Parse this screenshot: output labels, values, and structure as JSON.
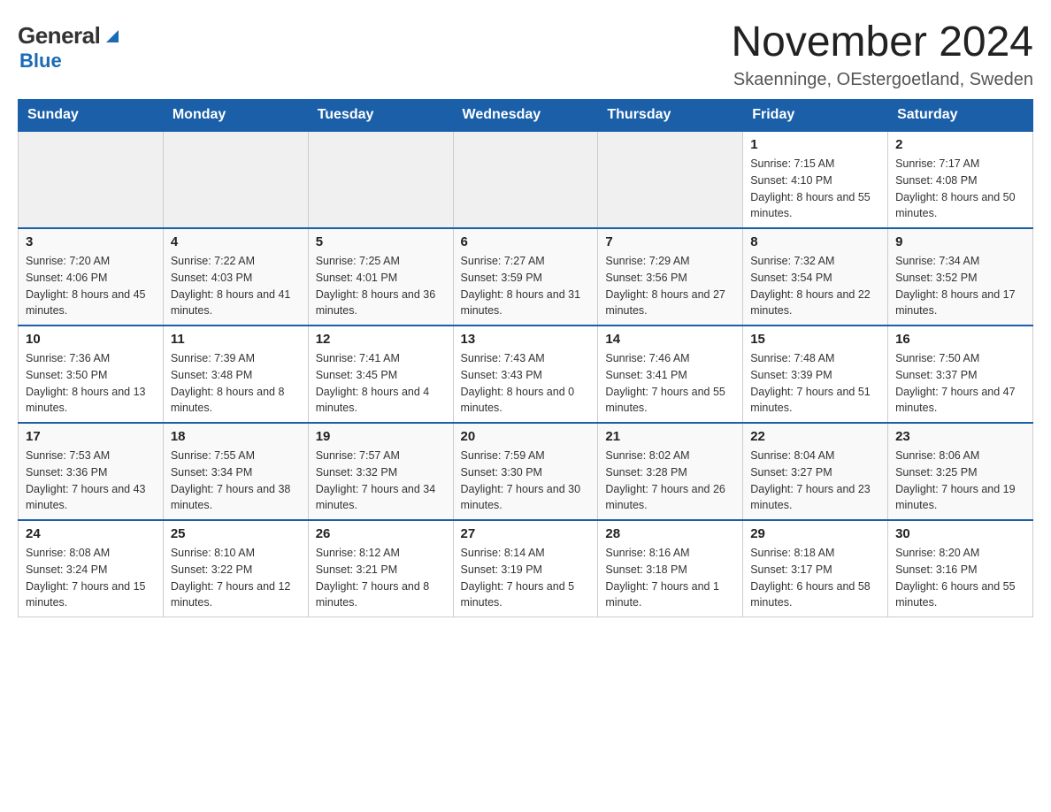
{
  "header": {
    "logo_general": "General",
    "logo_blue": "Blue",
    "main_title": "November 2024",
    "subtitle": "Skaenninge, OEstergoetland, Sweden"
  },
  "calendar": {
    "days_of_week": [
      "Sunday",
      "Monday",
      "Tuesday",
      "Wednesday",
      "Thursday",
      "Friday",
      "Saturday"
    ],
    "weeks": [
      [
        {
          "day": "",
          "info": ""
        },
        {
          "day": "",
          "info": ""
        },
        {
          "day": "",
          "info": ""
        },
        {
          "day": "",
          "info": ""
        },
        {
          "day": "",
          "info": ""
        },
        {
          "day": "1",
          "info": "Sunrise: 7:15 AM\nSunset: 4:10 PM\nDaylight: 8 hours and 55 minutes."
        },
        {
          "day": "2",
          "info": "Sunrise: 7:17 AM\nSunset: 4:08 PM\nDaylight: 8 hours and 50 minutes."
        }
      ],
      [
        {
          "day": "3",
          "info": "Sunrise: 7:20 AM\nSunset: 4:06 PM\nDaylight: 8 hours and 45 minutes."
        },
        {
          "day": "4",
          "info": "Sunrise: 7:22 AM\nSunset: 4:03 PM\nDaylight: 8 hours and 41 minutes."
        },
        {
          "day": "5",
          "info": "Sunrise: 7:25 AM\nSunset: 4:01 PM\nDaylight: 8 hours and 36 minutes."
        },
        {
          "day": "6",
          "info": "Sunrise: 7:27 AM\nSunset: 3:59 PM\nDaylight: 8 hours and 31 minutes."
        },
        {
          "day": "7",
          "info": "Sunrise: 7:29 AM\nSunset: 3:56 PM\nDaylight: 8 hours and 27 minutes."
        },
        {
          "day": "8",
          "info": "Sunrise: 7:32 AM\nSunset: 3:54 PM\nDaylight: 8 hours and 22 minutes."
        },
        {
          "day": "9",
          "info": "Sunrise: 7:34 AM\nSunset: 3:52 PM\nDaylight: 8 hours and 17 minutes."
        }
      ],
      [
        {
          "day": "10",
          "info": "Sunrise: 7:36 AM\nSunset: 3:50 PM\nDaylight: 8 hours and 13 minutes."
        },
        {
          "day": "11",
          "info": "Sunrise: 7:39 AM\nSunset: 3:48 PM\nDaylight: 8 hours and 8 minutes."
        },
        {
          "day": "12",
          "info": "Sunrise: 7:41 AM\nSunset: 3:45 PM\nDaylight: 8 hours and 4 minutes."
        },
        {
          "day": "13",
          "info": "Sunrise: 7:43 AM\nSunset: 3:43 PM\nDaylight: 8 hours and 0 minutes."
        },
        {
          "day": "14",
          "info": "Sunrise: 7:46 AM\nSunset: 3:41 PM\nDaylight: 7 hours and 55 minutes."
        },
        {
          "day": "15",
          "info": "Sunrise: 7:48 AM\nSunset: 3:39 PM\nDaylight: 7 hours and 51 minutes."
        },
        {
          "day": "16",
          "info": "Sunrise: 7:50 AM\nSunset: 3:37 PM\nDaylight: 7 hours and 47 minutes."
        }
      ],
      [
        {
          "day": "17",
          "info": "Sunrise: 7:53 AM\nSunset: 3:36 PM\nDaylight: 7 hours and 43 minutes."
        },
        {
          "day": "18",
          "info": "Sunrise: 7:55 AM\nSunset: 3:34 PM\nDaylight: 7 hours and 38 minutes."
        },
        {
          "day": "19",
          "info": "Sunrise: 7:57 AM\nSunset: 3:32 PM\nDaylight: 7 hours and 34 minutes."
        },
        {
          "day": "20",
          "info": "Sunrise: 7:59 AM\nSunset: 3:30 PM\nDaylight: 7 hours and 30 minutes."
        },
        {
          "day": "21",
          "info": "Sunrise: 8:02 AM\nSunset: 3:28 PM\nDaylight: 7 hours and 26 minutes."
        },
        {
          "day": "22",
          "info": "Sunrise: 8:04 AM\nSunset: 3:27 PM\nDaylight: 7 hours and 23 minutes."
        },
        {
          "day": "23",
          "info": "Sunrise: 8:06 AM\nSunset: 3:25 PM\nDaylight: 7 hours and 19 minutes."
        }
      ],
      [
        {
          "day": "24",
          "info": "Sunrise: 8:08 AM\nSunset: 3:24 PM\nDaylight: 7 hours and 15 minutes."
        },
        {
          "day": "25",
          "info": "Sunrise: 8:10 AM\nSunset: 3:22 PM\nDaylight: 7 hours and 12 minutes."
        },
        {
          "day": "26",
          "info": "Sunrise: 8:12 AM\nSunset: 3:21 PM\nDaylight: 7 hours and 8 minutes."
        },
        {
          "day": "27",
          "info": "Sunrise: 8:14 AM\nSunset: 3:19 PM\nDaylight: 7 hours and 5 minutes."
        },
        {
          "day": "28",
          "info": "Sunrise: 8:16 AM\nSunset: 3:18 PM\nDaylight: 7 hours and 1 minute."
        },
        {
          "day": "29",
          "info": "Sunrise: 8:18 AM\nSunset: 3:17 PM\nDaylight: 6 hours and 58 minutes."
        },
        {
          "day": "30",
          "info": "Sunrise: 8:20 AM\nSunset: 3:16 PM\nDaylight: 6 hours and 55 minutes."
        }
      ]
    ]
  }
}
